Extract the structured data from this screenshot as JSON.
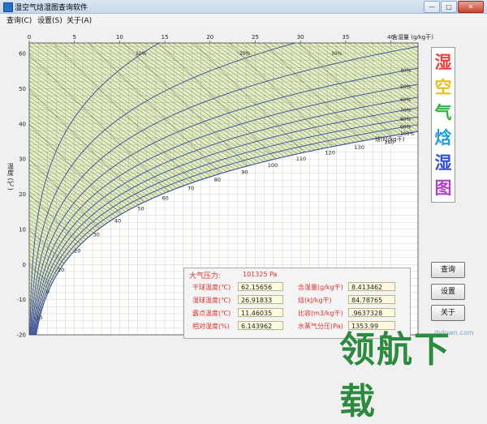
{
  "window": {
    "title": "湿空气焓湿图查询软件",
    "controls": [
      "—",
      "□",
      "✕"
    ]
  },
  "menu": [
    "查询(C)",
    "设置(S)",
    "关于(A)"
  ],
  "chart_data": {
    "type": "line",
    "title": "",
    "xlabel": "含湿量 (g/kg干)",
    "ylabel": "温度 (℃)",
    "xlim": [
      0,
      43
    ],
    "ylim": [
      -20,
      63
    ],
    "x_ticks": [
      "0",
      "5",
      "10",
      "15",
      "20",
      "25",
      "30",
      "35",
      "40"
    ],
    "y_ticks": [
      "60",
      "50",
      "40",
      "30",
      "20",
      "10",
      "0",
      "-10",
      "-20"
    ],
    "rh_labels": [
      "10%",
      "20%",
      "30%",
      "40%",
      "50%",
      "60%",
      "70%",
      "80%",
      "90%",
      "100%"
    ],
    "rh_curves": [
      10,
      20,
      30,
      40,
      50,
      60,
      70,
      80,
      90,
      100
    ],
    "enthalpy_label": "焓(kJ/kg干)",
    "enthalpy_ticks": [
      "-10",
      "0",
      "10",
      "20",
      "30",
      "40",
      "50",
      "60",
      "70",
      "80",
      "90",
      "100",
      "110",
      "120",
      "130",
      "140"
    ],
    "enthalpy_lines": [
      -10,
      0,
      10,
      20,
      30,
      40,
      50,
      60,
      70,
      80,
      90,
      100,
      110,
      120,
      130,
      140
    ],
    "grid": true,
    "colors": {
      "rh_curve": "#3a4d9c",
      "hatch": "#000000",
      "background": "#fffff5",
      "frame": "#444444"
    }
  },
  "side_title": [
    "湿",
    "空",
    "气",
    "焓",
    "湿",
    "图"
  ],
  "side_title_colors": [
    "#e84040",
    "#e8c020",
    "#30b040",
    "#20a0d8",
    "#3050d0",
    "#b040c8"
  ],
  "results": {
    "atm_label": "大气压力:",
    "atm_value": "101325 Pa",
    "left": [
      {
        "label": "干球温度(℃)",
        "value": "62.15656"
      },
      {
        "label": "湿球温度(℃)",
        "value": "26.91833"
      },
      {
        "label": "露点温度(℃)",
        "value": "11.46035"
      },
      {
        "label": "相对湿度(%)",
        "value": "6.143962"
      }
    ],
    "right": [
      {
        "label": "含湿量(g/kg干)",
        "value": "8.413462"
      },
      {
        "label": "焓(kJ/kg干)",
        "value": "84.78765"
      },
      {
        "label": "比容(m3/kg干)",
        "value": ".9637328"
      },
      {
        "label": "水蒸气分压(Pa)",
        "value": "1353.99"
      }
    ]
  },
  "buttons": {
    "query": "查询",
    "settings": "设置",
    "about": "关于"
  },
  "watermark": {
    "url": "lhdown.com",
    "brand": "领航下载"
  }
}
